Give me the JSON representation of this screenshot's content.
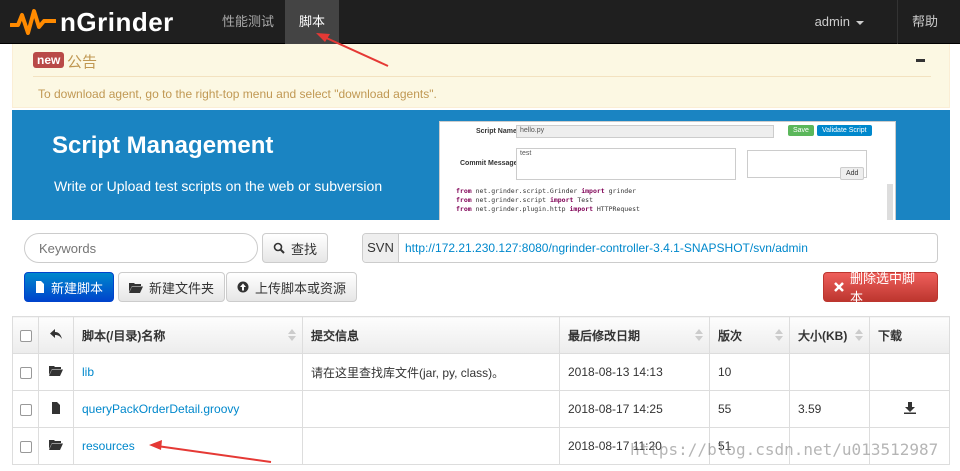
{
  "nav": {
    "brand": "nGrinder",
    "items": [
      "性能测试",
      "脚本"
    ],
    "user": "admin",
    "help": "帮助"
  },
  "notice": {
    "badge": "new",
    "title": "公告",
    "text": "To download agent, go to the right-top menu and select \"download agents\"."
  },
  "banner": {
    "title": "Script Management",
    "subtitle": "Write or Upload test scripts on the web or subversion",
    "preview": {
      "script_name_label": "Script Name",
      "script_name_value": "hello.py",
      "save": "Save",
      "validate": "Validate Script",
      "commit_label": "Commit Message",
      "commit_value": "test",
      "add": "Add",
      "code": [
        [
          "from",
          " net.grinder.script.Grinder ",
          "import",
          " grinder"
        ],
        [
          "from",
          " net.grinder.script ",
          "import",
          " Test"
        ],
        [
          "from",
          " net.grinder.plugin.http ",
          "import",
          " HTTPRequest"
        ]
      ]
    }
  },
  "toolbar": {
    "search_placeholder": "Keywords",
    "search_btn": "查找",
    "svn_label": "SVN",
    "svn_url": "http://172.21.230.127:8080/ngrinder-controller-3.4.1-SNAPSHOT/svn/admin",
    "new_script": "新建脚本",
    "new_folder": "新建文件夹",
    "upload": "上传脚本或资源",
    "delete": "删除选中脚本"
  },
  "table": {
    "headers": [
      "脚本(/目录)名称",
      "提交信息",
      "最后修改日期",
      "版次",
      "大小(KB)",
      "下载"
    ],
    "rows": [
      {
        "type": "folder",
        "name": "lib",
        "message": "请在这里查找库文件(jar, py, class)。",
        "date": "2018-08-13 14:13",
        "rev": "10",
        "size": "",
        "download": false
      },
      {
        "type": "file",
        "name": "queryPackOrderDetail.groovy",
        "message": "",
        "date": "2018-08-17 14:25",
        "rev": "55",
        "size": "3.59",
        "download": true
      },
      {
        "type": "folder",
        "name": "resources",
        "message": "",
        "date": "2018-08-17 11:20",
        "rev": "51",
        "size": "",
        "download": false
      }
    ]
  },
  "watermark": "https://blog.csdn.net/u013512987",
  "colors": {
    "accent": "#0088cc",
    "danger": "#da4f49",
    "annotation": "#e53935",
    "banner": "#1a84c2"
  }
}
